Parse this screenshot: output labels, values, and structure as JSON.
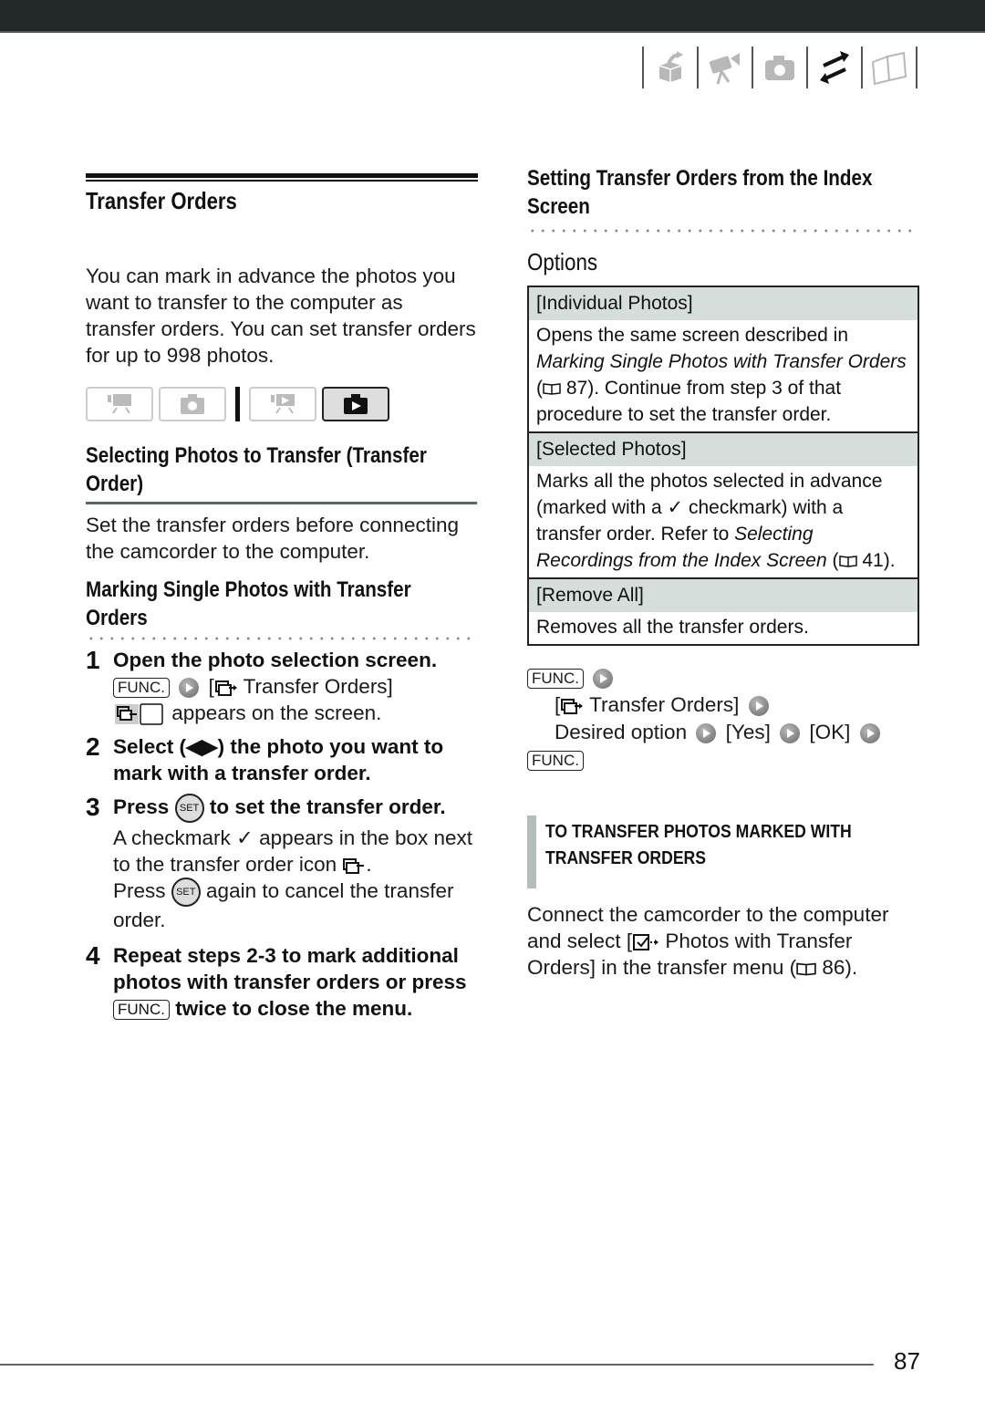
{
  "header": {
    "bar_color": "#222827",
    "nav_icons": [
      "getting-started-icon",
      "video-icon",
      "photo-icon",
      "transfer-icon",
      "reference-book-icon"
    ],
    "active_nav_icon": "transfer-icon"
  },
  "left": {
    "title": "Transfer Orders",
    "intro": "You can mark in advance the photos you want to transfer to the computer as transfer orders. You can set transfer orders for up to 998 photos.",
    "modes": [
      {
        "icon": "movie-record-icon",
        "active": false
      },
      {
        "icon": "photo-record-icon",
        "active": false
      },
      {
        "icon": "movie-playback-icon",
        "active": false
      },
      {
        "icon": "photo-playback-icon",
        "active": true
      }
    ],
    "section_title": "Selecting Photos to Transfer (Transfer Order)",
    "section_text": "Set the transfer orders before connecting the camcorder to the computer.",
    "subsection_title": "Marking Single Photos with Transfer Orders",
    "steps": [
      {
        "num": "1",
        "title": "Open the photo selection screen.",
        "func_label": "FUNC.",
        "bracket_open": "[",
        "menu_item": "Transfer Orders]",
        "appears_text": "appears on the screen."
      },
      {
        "num": "2",
        "title": "Select (◀▶) the photo you want to mark with a transfer order."
      },
      {
        "num": "3",
        "title_pre": "Press",
        "set_label": "SET",
        "title_post": "to set the transfer order.",
        "body_1": "A checkmark ✓ appears in the box next to the transfer order icon",
        "body_1_end": ".",
        "body_2_pre": "Press",
        "body_2_post": "again to cancel the transfer order."
      },
      {
        "num": "4",
        "title_pre": "Repeat steps 2-3 to mark additional photos with transfer orders or press",
        "func_label": "FUNC.",
        "title_post": "twice to close the menu."
      }
    ]
  },
  "right": {
    "section_title": "Setting Transfer Orders from the Index Screen",
    "options_title": "Options",
    "options": [
      {
        "label": "[Individual Photos]",
        "desc_pre": "Opens the same screen described in ",
        "desc_ref": "Marking Single Photos with Transfer Orders",
        "desc_page": "87).",
        "desc_post": "Continue from step 3 of that procedure to set the transfer order."
      },
      {
        "label": "[Selected Photos]",
        "desc_pre": "Marks all the photos selected in advance (marked with a ✓ checkmark) with a transfer order. Refer to ",
        "desc_ref": "Selecting Recordings from the Index Screen",
        "desc_page": "41)."
      },
      {
        "label": "[Remove All]",
        "desc_pre": "Removes all the transfer orders."
      }
    ],
    "procedure": {
      "func_label": "FUNC.",
      "menu_item": "Transfer Orders]",
      "bracket_open": "[",
      "desired": "Desired option",
      "yes": "[Yes]",
      "ok": "[OK]",
      "func_label_end": "FUNC."
    },
    "note": {
      "title_line1": "To transfer photos marked with",
      "title_line2": "transfer orders",
      "text_pre": "Connect the camcorder to the computer and select [",
      "text_post": " Photos with Transfer Orders] in the transfer menu (",
      "page": "86)."
    }
  },
  "footer": {
    "page_number": "87"
  }
}
